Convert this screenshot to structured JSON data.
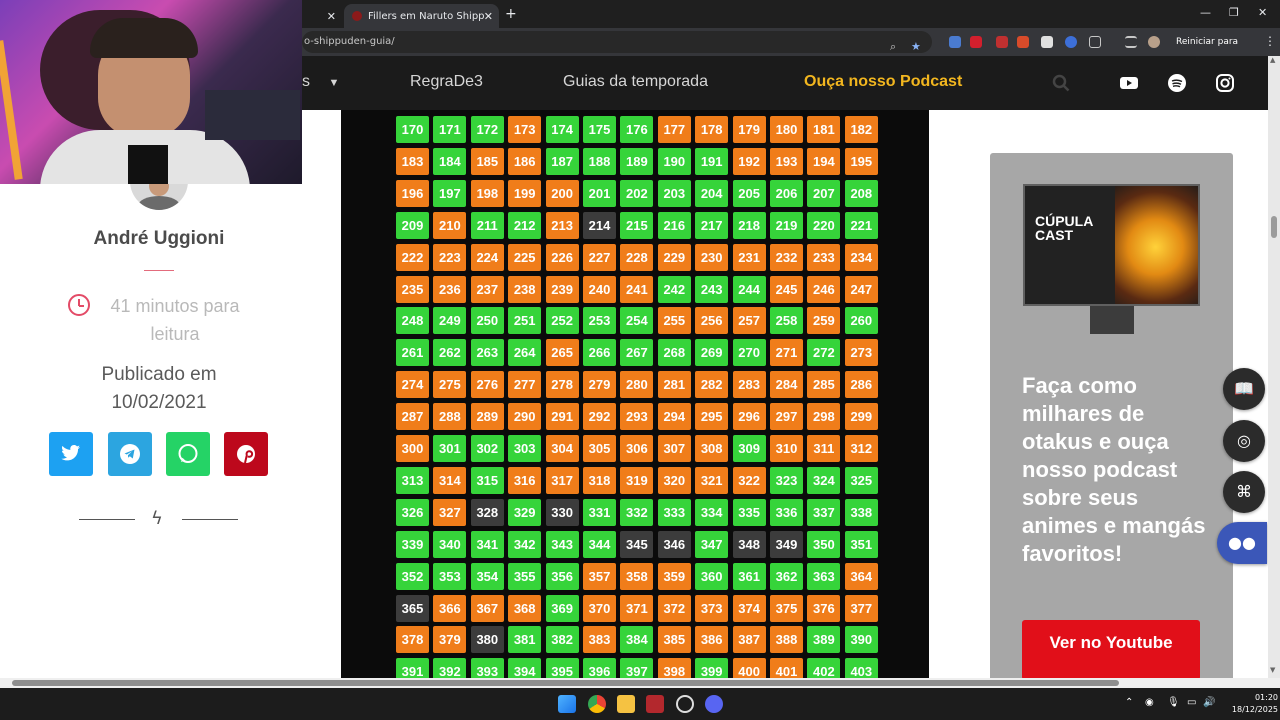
{
  "browser": {
    "active_tab_title": "Fillers em Naruto Shippuden: s",
    "url": "o-shippuden-guia/",
    "update_button": "Reiniciar para atualizar"
  },
  "site_nav": {
    "partial_item": "s",
    "items": [
      "RegraDe3",
      "Guias da temporada"
    ],
    "podcast_link": "Ouça nosso Podcast"
  },
  "author": {
    "name": "André Uggioni",
    "read_time": "41 minutos para leitura",
    "published_label": "Publicado em",
    "published_date": "10/02/2021"
  },
  "colors": {
    "canon": "#36d43a",
    "filler": "#f07d1a",
    "mixed": "#3c3c3c",
    "twitter": "#1da1f2",
    "telegram": "#2ca5e0",
    "whatsapp": "#25d366",
    "pinterest": "#bd081c",
    "youtube_red": "#e10f19",
    "accent_yellow": "#f2b61f"
  },
  "episode_grid": {
    "columns": 13,
    "start": 170,
    "end": 403,
    "status": "cccfcccfffffffcffcccccfffffcfffcccccccccfccfmcccccccffffffffffffffffffffcccfffcccccccfffcfcccccfcccccfcffffffffffffffffffffffffffffcccfffffcfffcfcfffffffccccfmcmccccccccccccccmmcmmcccccccfffccccfmfffcffffffffffmccfcffffcccccccccfcffcccccccmmcfffffcffcccfcffcffff"
  },
  "podcast": {
    "cover_title": "CÚPULA CAST",
    "promo_text": "Faça como milhares de otakus e ouça nosso podcast sobre seus animes e mangás favoritos!",
    "button_label": "Ver no Youtube"
  },
  "taskbar": {
    "time": "01:20",
    "date": "18/12/2025"
  }
}
